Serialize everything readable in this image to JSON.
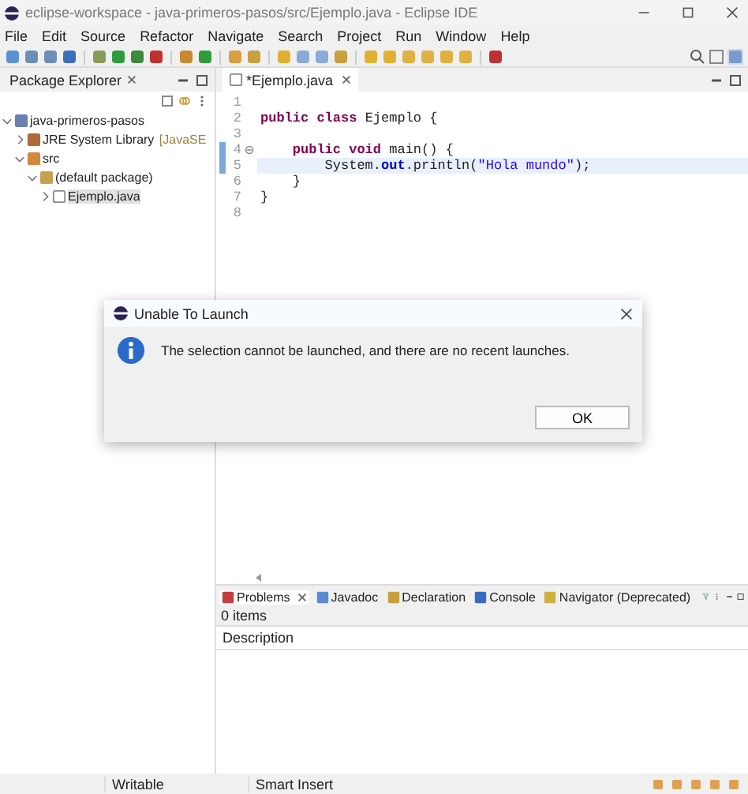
{
  "window": {
    "title": "eclipse-workspace - java-primeros-pasos/src/Ejemplo.java - Eclipse IDE"
  },
  "menu": [
    "File",
    "Edit",
    "Source",
    "Refactor",
    "Navigate",
    "Search",
    "Project",
    "Run",
    "Window",
    "Help"
  ],
  "package_explorer": {
    "title": "Package Explorer",
    "tree": [
      {
        "label": "java-primeros-pasos",
        "kind": "project",
        "expanded": true,
        "selected": false,
        "children": [
          {
            "label": "JRE System Library",
            "decoration": "[JavaSE",
            "kind": "library",
            "expanded": false,
            "selected": false
          },
          {
            "label": "src",
            "kind": "folder",
            "expanded": true,
            "selected": false,
            "children": [
              {
                "label": "(default package)",
                "kind": "package",
                "expanded": true,
                "selected": false,
                "children": [
                  {
                    "label": "Ejemplo.java",
                    "kind": "file",
                    "expanded": false,
                    "selected": true
                  }
                ]
              }
            ]
          }
        ]
      }
    ]
  },
  "editor": {
    "tab": "*Ejemplo.java",
    "lines": [
      {
        "number": "1",
        "highlighted": false,
        "fold": false
      },
      {
        "number": "2",
        "highlighted": false,
        "fold": false,
        "segments": [
          {
            "kind": "kw",
            "text": "public class "
          },
          {
            "kind": "plain",
            "text": "Ejemplo {"
          }
        ]
      },
      {
        "number": "3",
        "highlighted": false,
        "fold": false
      },
      {
        "number": "4",
        "highlighted": false,
        "fold": true,
        "segments": [
          {
            "kind": "kw",
            "text": "    public void "
          },
          {
            "kind": "plain",
            "text": "main() {"
          }
        ]
      },
      {
        "number": "5",
        "highlighted": true,
        "fold": false,
        "segments": [
          {
            "kind": "plain",
            "text": "        System."
          },
          {
            "kind": "field",
            "text": "out"
          },
          {
            "kind": "plain",
            "text": ".println("
          },
          {
            "kind": "str",
            "text": "\"Hola mundo\""
          },
          {
            "kind": "plain",
            "text": ");"
          }
        ]
      },
      {
        "number": "6",
        "highlighted": false,
        "fold": false,
        "segments": [
          {
            "kind": "plain",
            "text": "    }"
          }
        ]
      },
      {
        "number": "7",
        "highlighted": false,
        "fold": false,
        "segments": [
          {
            "kind": "plain",
            "text": "}"
          }
        ]
      },
      {
        "number": "8",
        "highlighted": false,
        "fold": false
      }
    ]
  },
  "bottom_panel": {
    "tabs": [
      {
        "label": "Problems",
        "kind": "problems",
        "selected": true
      },
      {
        "label": "Javadoc",
        "kind": "javadoc",
        "selected": false
      },
      {
        "label": "Declaration",
        "kind": "declaration",
        "selected": false
      },
      {
        "label": "Console",
        "kind": "console",
        "selected": false
      },
      {
        "label": "Navigator (Deprecated)",
        "kind": "navigator",
        "selected": false
      }
    ],
    "count": "0 items",
    "columns": [
      "Description"
    ]
  },
  "status_bar": [
    "Writable",
    "Smart Insert"
  ],
  "dialog": {
    "title": "Unable To Launch",
    "message": "The selection cannot be launched, and there are no recent launches.",
    "buttons": [
      "OK"
    ]
  }
}
